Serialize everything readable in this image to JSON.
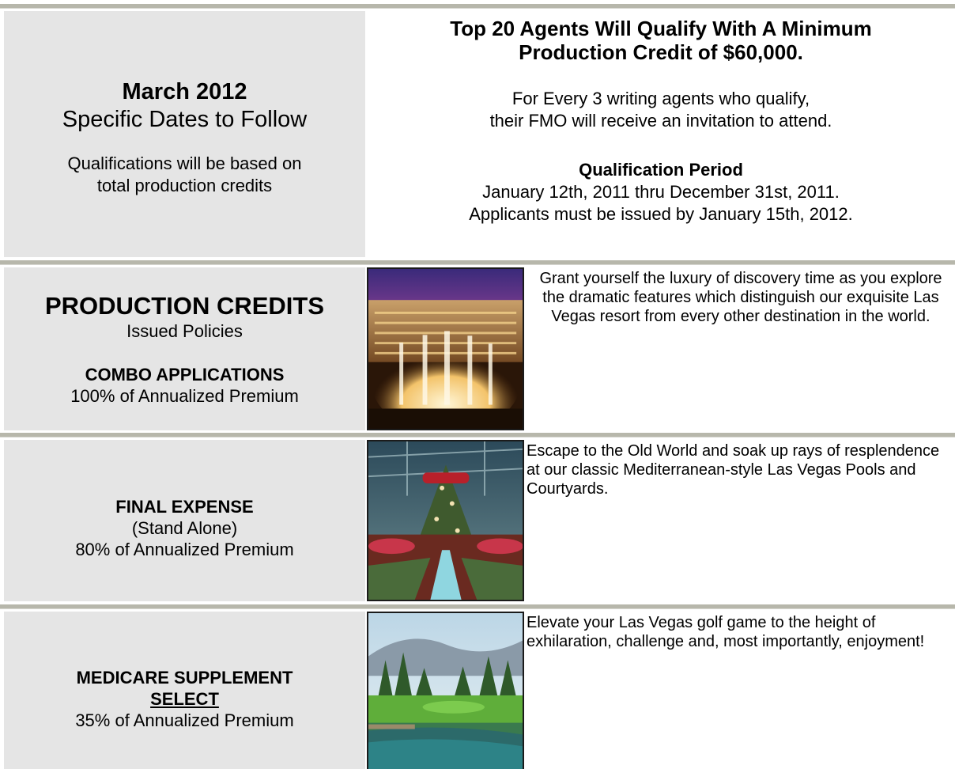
{
  "header": {
    "left": {
      "date": "March 2012",
      "subtitle": "Specific Dates to Follow",
      "note_line1": "Qualifications will be based on",
      "note_line2": "total production credits"
    },
    "right": {
      "headline_line1": "Top 20 Agents Will Qualify With A Minimum",
      "headline_line2": "Production Credit of $60,000.",
      "fmo_line1": "For Every 3 writing agents who qualify,",
      "fmo_line2": "their FMO will receive an invitation to attend.",
      "period_title": "Qualification Period",
      "period_line1": "January 12th, 2011 thru December 31st, 2011.",
      "period_line2": "Applicants must be issued by January 15th, 2012."
    }
  },
  "rows": [
    {
      "title": "PRODUCTION CREDITS",
      "subtitle": "Issued Policies",
      "category": "COMBO APPLICATIONS",
      "rate": "100% of Annualized Premium",
      "photo_icon": "bellagio-fountain-photo",
      "description": "Grant yourself the luxury of discovery time as you explore the dramatic features which distinguish our exquisite Las Vegas resort from every other destination in the world."
    },
    {
      "category": "FINAL EXPENSE",
      "qualifier": "(Stand Alone)",
      "rate": "80% of Annualized Premium",
      "photo_icon": "conservatory-photo",
      "description": "Escape to the Old World and soak up rays of resplendence at our classic Mediterranean-style Las Vegas Pools and Courtyards."
    },
    {
      "category": "MEDICARE SUPPLEMENT",
      "qualifier": "SELECT",
      "rate": "35% of Annualized Premium",
      "photo_icon": "golf-course-photo",
      "description": "Elevate your Las Vegas golf game to the height of exhilaration, challenge and, most importantly, enjoyment!"
    }
  ]
}
